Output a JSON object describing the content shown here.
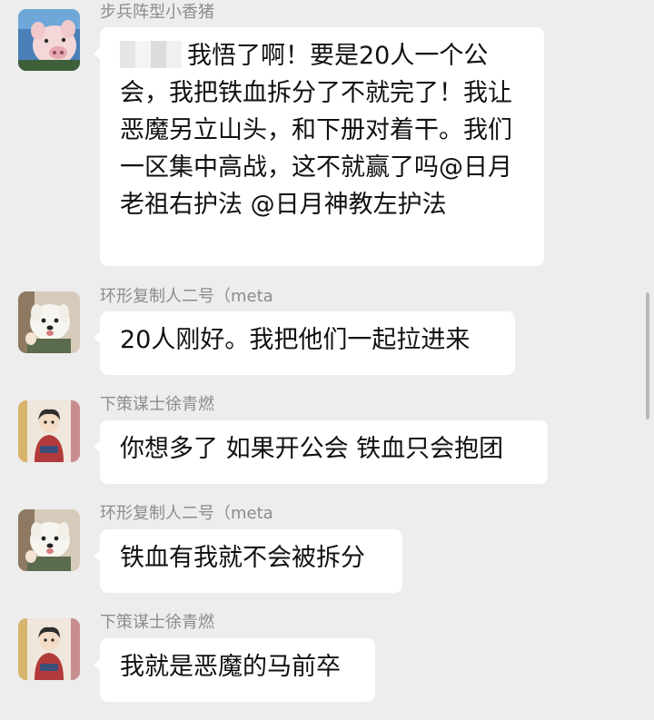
{
  "chat": {
    "messages": [
      {
        "sender": "步兵阵型小香猪",
        "avatar": "pig-avatar",
        "text": "我悟了啊！要是20人一个公会，我把铁血拆分了不就完了！我让恶魔另立山头，和下册对着干。我们一区集中高战，这不就赢了吗@日月老祖右护法 @日月神教左护法"
      },
      {
        "sender": "环形复制人二号（meta",
        "avatar": "dog-avatar",
        "text": "20人刚好。我把他们一起拉进来"
      },
      {
        "sender": "下策谋士徐青燃",
        "avatar": "cartoon-person-avatar",
        "text": "你想多了 如果开公会 铁血只会抱团"
      },
      {
        "sender": "环形复制人二号（meta",
        "avatar": "dog-avatar",
        "text": "铁血有我就不会被拆分"
      },
      {
        "sender": "下策谋士徐青燃",
        "avatar": "cartoon-person-avatar",
        "text": "我就是恶魔的马前卒"
      }
    ]
  }
}
